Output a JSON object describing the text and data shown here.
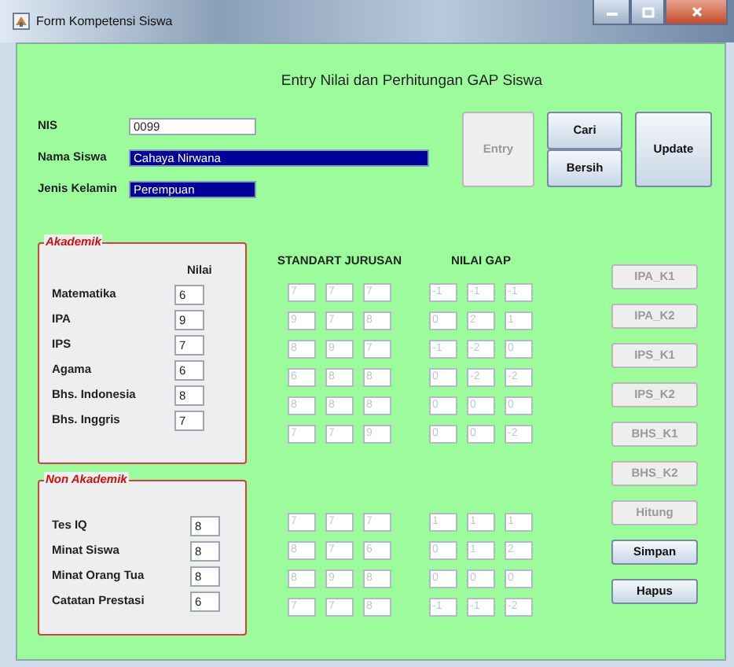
{
  "window": {
    "title": "Form Kompetensi Siswa"
  },
  "heading": "Entry Nilai dan Perhitungan GAP Siswa",
  "fields": [
    {
      "label": "NIS",
      "value": "0099",
      "selected": false
    },
    {
      "label": "Nama Siswa",
      "value": "Cahaya Nirwana",
      "selected": true
    },
    {
      "label": "Jenis Kelamin",
      "value": "Perempuan",
      "selected": true
    }
  ],
  "top_buttons": [
    {
      "label": "Entry",
      "disabled": true
    },
    {
      "label": "Cari",
      "disabled": false
    },
    {
      "label": "Bersih",
      "disabled": false
    },
    {
      "label": "Update",
      "disabled": false
    }
  ],
  "standard_header": "STANDART JURUSAN",
  "gap_header": "NILAI GAP",
  "groups": [
    {
      "title": "Akademik",
      "column_header": "Nilai",
      "rows": [
        {
          "label": "Matematika",
          "value": "6",
          "standard": [
            "7",
            "7",
            "7"
          ],
          "gap": [
            "-1",
            "-1",
            "-1"
          ]
        },
        {
          "label": "IPA",
          "value": "9",
          "standard": [
            "9",
            "7",
            "8"
          ],
          "gap": [
            "0",
            "2",
            "1"
          ]
        },
        {
          "label": "IPS",
          "value": "7",
          "standard": [
            "8",
            "9",
            "7"
          ],
          "gap": [
            "-1",
            "-2",
            "0"
          ]
        },
        {
          "label": "Agama",
          "value": "6",
          "standard": [
            "6",
            "8",
            "8"
          ],
          "gap": [
            "0",
            "-2",
            "-2"
          ]
        },
        {
          "label": "Bhs. Indonesia",
          "value": "8",
          "standard": [
            "8",
            "8",
            "8"
          ],
          "gap": [
            "0",
            "0",
            "0"
          ]
        },
        {
          "label": "Bhs. Inggris",
          "value": "7",
          "standard": [
            "7",
            "7",
            "9"
          ],
          "gap": [
            "0",
            "0",
            "-2"
          ]
        }
      ]
    },
    {
      "title": "Non Akademik",
      "rows": [
        {
          "label": "Tes IQ",
          "value": "8",
          "standard": [
            "7",
            "7",
            "7"
          ],
          "gap": [
            "1",
            "1",
            "1"
          ]
        },
        {
          "label": "Minat Siswa",
          "value": "8",
          "standard": [
            "8",
            "7",
            "6"
          ],
          "gap": [
            "0",
            "1",
            "2"
          ]
        },
        {
          "label": "Minat Orang Tua",
          "value": "8",
          "standard": [
            "8",
            "9",
            "8"
          ],
          "gap": [
            "0",
            "0",
            "0"
          ]
        },
        {
          "label": "Catatan Prestasi",
          "value": "6",
          "standard": [
            "7",
            "7",
            "8"
          ],
          "gap": [
            "-1",
            "-1",
            "-2"
          ]
        }
      ]
    }
  ],
  "side_buttons": [
    {
      "label": "IPA_K1",
      "disabled": true
    },
    {
      "label": "IPA_K2",
      "disabled": true
    },
    {
      "label": "IPS_K1",
      "disabled": true
    },
    {
      "label": "IPS_K2",
      "disabled": true
    },
    {
      "label": "BHS_K1",
      "disabled": true
    },
    {
      "label": "BHS_K2",
      "disabled": true
    },
    {
      "label": "Hitung",
      "disabled": true
    },
    {
      "label": "Simpan",
      "disabled": false
    },
    {
      "label": "Hapus",
      "disabled": false
    }
  ]
}
